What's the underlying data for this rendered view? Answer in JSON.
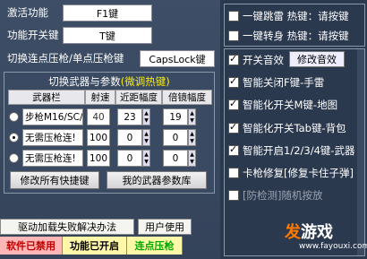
{
  "left": {
    "activate_label": "激活功能",
    "activate_value": "F1键",
    "toggle_label": "功能开关键",
    "toggle_value": "T键",
    "switch_label": "切换连点压枪/单点压枪键",
    "switch_value": "CapsLock键",
    "params_title": "切换武器与参数",
    "params_hotkey": "(微调热键)",
    "headers": [
      "武器栏",
      "射速",
      "近距幅度",
      "倍镜幅度"
    ],
    "weapons": [
      {
        "name": "步枪M16/SC/",
        "speed": "40",
        "near": "23",
        "scope": "19",
        "selected": false
      },
      {
        "name": "无需压枪连!",
        "speed": "100",
        "near": "0",
        "scope": "0",
        "selected": true
      },
      {
        "name": "无需压枪连!",
        "speed": "100",
        "near": "0",
        "scope": "0",
        "selected": false
      }
    ],
    "btn_modify_all": "修改所有快捷键",
    "btn_my_weapons": "我的武器参数库",
    "btn_driver": "驱动加载失败解决办法",
    "btn_user": "用户使用",
    "status_software": "软件已禁用",
    "status_function": "功能已开启",
    "status_burst": "连点压枪"
  },
  "right": {
    "top_items": [
      {
        "label": "一键跳雷 热键：请按键",
        "checked": false
      },
      {
        "label": "一键转身 热键：请按键",
        "checked": false
      }
    ],
    "sound_label": "开关音效",
    "sound_checked": true,
    "modify_sound": "修改音效",
    "items": [
      {
        "label": "智能关闭F键-手雷",
        "checked": true,
        "dim": false
      },
      {
        "label": "智能化开关M键-地图",
        "checked": true,
        "dim": false
      },
      {
        "label": "智能化开关Tab键-背包",
        "checked": true,
        "dim": false
      },
      {
        "label": "智能开启1/2/3/4键-武器",
        "checked": true,
        "dim": false
      },
      {
        "label": "卡枪修复[修复卡住子弹]",
        "checked": false,
        "dim": false
      },
      {
        "label": "[防检测]随机按放",
        "checked": false,
        "dim": true
      }
    ]
  },
  "watermark": {
    "text_a": "发",
    "text_b": "游戏",
    "url": "www.fayouxi.com"
  },
  "colors": {
    "disabled_bg": "#ffb6b6",
    "disabled_fg": "#c00000",
    "enabled_bg": "#fff8a8",
    "burst_fg": "#00aa00"
  }
}
